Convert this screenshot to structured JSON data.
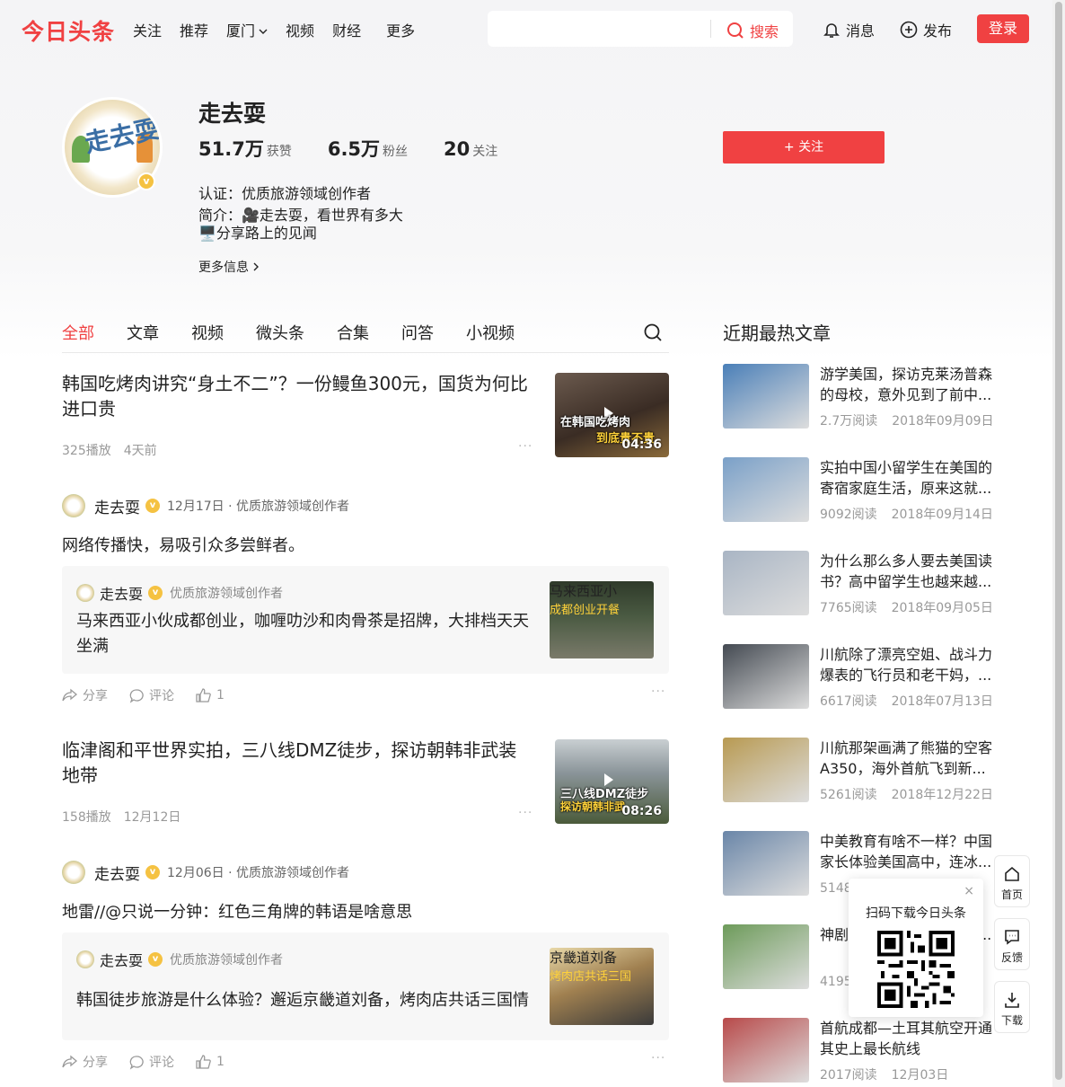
{
  "header": {
    "logo": "今日头条",
    "nav": [
      "关注",
      "推荐",
      "厦门",
      "视频",
      "财经",
      "更多"
    ],
    "search_placeholder": "",
    "search_button": "搜索",
    "messages": "消息",
    "publish": "发布",
    "login": "登录"
  },
  "profile": {
    "name": "走去耍",
    "avatar_text": "走去耍",
    "stats": [
      {
        "num": "51.7万",
        "label": "获赞"
      },
      {
        "num": "6.5万",
        "label": "粉丝"
      },
      {
        "num": "20",
        "label": "关注"
      }
    ],
    "follow_button": "+ 关注",
    "certification": "认证：优质旅游领域创作者",
    "bio": "简介：🎥走去耍，看世界有多大\n🖥️分享路上的见闻",
    "more_info": "更多信息"
  },
  "tabs": [
    "全部",
    "文章",
    "视频",
    "微头条",
    "合集",
    "问答",
    "小视频"
  ],
  "feed": {
    "video1": {
      "title": "韩国吃烤肉讲究“身土不二”？一份鳗鱼300元，国货为何比进口贵",
      "plays": "325播放",
      "time": "4天前",
      "duration": "04:36",
      "caption1": "在韩国吃烤肉",
      "caption2": "到底贵不贵"
    },
    "post1": {
      "author": "走去耍",
      "info": "12月17日 · 优质旅游领域创作者",
      "text": "网络传播快，易吸引众多尝鲜者。",
      "quote_author": "走去耍",
      "quote_info": "优质旅游领域创作者",
      "quote_text": "马来西亚小伙成都创业，咖喱叻沙和肉骨茶是招牌，大排档天天坐满",
      "quote_caption1": "马来西亚小",
      "quote_caption2": "成都创业开餐",
      "share": "分享",
      "comment": "评论",
      "likes": "1"
    },
    "video2": {
      "title": "临津阁和平世界实拍，三八线DMZ徒步，探访朝韩非武装地带",
      "plays": "158播放",
      "time": "12月12日",
      "duration": "08:26",
      "caption1": "三八线DMZ徒步",
      "caption2": "探访朝韩非武"
    },
    "post2": {
      "author": "走去耍",
      "info": "12月06日 · 优质旅游领域创作者",
      "text": "地雷//@只说一分钟：红色三角牌的韩语是啥意思",
      "quote_author": "走去耍",
      "quote_info": "优质旅游领域创作者",
      "quote_text": "韩国徒步旅游是什么体验？邂逅京畿道刘备，烤肉店共话三国情",
      "quote_caption1": "京畿道刘备",
      "quote_caption2": "烤肉店共话三国",
      "share": "分享",
      "comment": "评论",
      "likes": "1"
    }
  },
  "sidebar": {
    "title": "近期最热文章",
    "items": [
      {
        "title": "游学美国，探访克莱汤普森的母校，意外见到了前中...",
        "reads": "2.7万阅读",
        "date": "2018年09月09日",
        "color": "#4a7fb8"
      },
      {
        "title": "实拍中国小留学生在美国的寄宿家庭生活，原来这就...",
        "reads": "9092阅读",
        "date": "2018年09月14日",
        "color": "#7aa0c8"
      },
      {
        "title": "为什么那么多人要去美国读书？高中留学生也越来越...",
        "reads": "7765阅读",
        "date": "2018年09月05日",
        "color": "#a9b5c4"
      },
      {
        "title": "川航除了漂亮空姐、战斗力爆表的飞行员和老干妈，...",
        "reads": "6617阅读",
        "date": "2018年07月13日",
        "color": "#444a52"
      },
      {
        "title": "川航那架画满了熊猫的空客A350，海外首航飞到新...",
        "reads": "5261阅读",
        "date": "2018年12月22日",
        "color": "#b89a52"
      },
      {
        "title": "中美教育有啥不一样？中国家长体验美国高中，连冰...",
        "reads": "5148阅读",
        "date": "",
        "color": "#6a86a8"
      },
      {
        "title": "神剧中的熊猫宝宝在出逃...",
        "reads": "4195阅读",
        "date": "",
        "color": "#6d9b5a"
      },
      {
        "title": "首航成都—土耳其航空开通其史上最长航线",
        "reads": "2017阅读",
        "date": "12月03日",
        "color": "#b84a4a"
      }
    ]
  },
  "floating": {
    "home": "首页",
    "feedback": "反馈",
    "download": "下载",
    "qr_title": "扫码下载今日头条",
    "qr_close": "×"
  }
}
